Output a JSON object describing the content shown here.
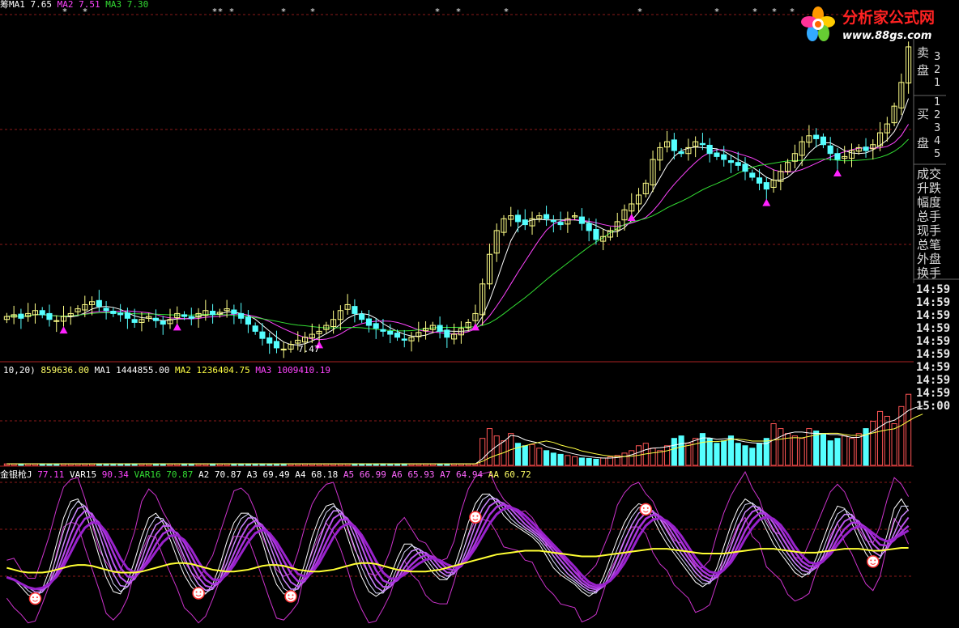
{
  "panels": {
    "price": {
      "legend": [
        {
          "text": "筹MA1",
          "color": "#ffffff"
        },
        {
          "text": "7.65",
          "color": "#ffffff"
        },
        {
          "text": "MA2",
          "color": "#ff44ff"
        },
        {
          "text": "7.51",
          "color": "#ff44ff"
        },
        {
          "text": "MA3",
          "color": "#33dd33"
        },
        {
          "text": "7.30",
          "color": "#33dd33"
        }
      ],
      "low_annotation": "7.47"
    },
    "volume": {
      "legend": [
        {
          "text": "10,20)",
          "color": "#ffffff"
        },
        {
          "text": "859636.00",
          "color": "#ffff66"
        },
        {
          "text": "MA1",
          "color": "#ffffff"
        },
        {
          "text": "1444855.00",
          "color": "#ffffff"
        },
        {
          "text": "MA2",
          "color": "#ffff44"
        },
        {
          "text": "1236404.75",
          "color": "#ffff44"
        },
        {
          "text": "MA3",
          "color": "#ff44ff"
        },
        {
          "text": "1009410.19",
          "color": "#ff44ff"
        }
      ]
    },
    "indicator": {
      "legend": [
        {
          "text": "金银枪J",
          "color": "#ffffff"
        },
        {
          "text": "77.11",
          "color": "#ff44ff"
        },
        {
          "text": "VAR15",
          "color": "#ffffff"
        },
        {
          "text": "90.34",
          "color": "#ff44ff"
        },
        {
          "text": "VAR16",
          "color": "#33dd33"
        },
        {
          "text": "70.87",
          "color": "#33dd33"
        },
        {
          "text": "A2",
          "color": "#ffffff"
        },
        {
          "text": "70.87",
          "color": "#ffffff"
        },
        {
          "text": "A3",
          "color": "#ffffff"
        },
        {
          "text": "69.49",
          "color": "#ffffff"
        },
        {
          "text": "A4",
          "color": "#ffffff"
        },
        {
          "text": "68.18",
          "color": "#ffffff"
        },
        {
          "text": "A5",
          "color": "#ff66ff"
        },
        {
          "text": "66.99",
          "color": "#ff66ff"
        },
        {
          "text": "A6",
          "color": "#ff66ff"
        },
        {
          "text": "65.93",
          "color": "#ff66ff"
        },
        {
          "text": "A7",
          "color": "#ff66ff"
        },
        {
          "text": "64.94",
          "color": "#ff66ff"
        },
        {
          "text": "AA",
          "color": "#ffff66"
        },
        {
          "text": "60.72",
          "color": "#ffff66"
        }
      ]
    }
  },
  "side_panel": {
    "sell_label": [
      "卖",
      "盘"
    ],
    "sell_nums": [
      "3",
      "2",
      "1"
    ],
    "buy_label": [
      "买",
      "盘"
    ],
    "buy_nums": [
      "1",
      "2",
      "3",
      "4",
      "5"
    ],
    "fields": [
      "成交",
      "升跌",
      "幅度",
      "总手",
      "现手",
      "总笔",
      "外盘",
      "换手"
    ],
    "times": [
      "14:59",
      "14:59",
      "14:59",
      "14:59",
      "14:59",
      "14:59",
      "14:59",
      "14:59",
      "14:59",
      "15:00"
    ]
  },
  "watermark": {
    "name": "分析家公式网",
    "url": "www.88gs.com"
  },
  "colors": {
    "up_candle": "#ffff88",
    "down_candle": "#55ffff",
    "vol_up": "#ff5555",
    "vol_down": "#55ffff",
    "grid": "#8b1a1a",
    "ma1": "#ffffff",
    "ma2": "#ff44ff",
    "ma3": "#33dd33",
    "signal": "#ff22ff",
    "aa": "#ffff33"
  },
  "chart_data": {
    "type": "candlestick",
    "bars": 128,
    "price": {
      "ylim": [
        6.5,
        12.4
      ],
      "close": [
        7.25,
        7.28,
        7.22,
        7.3,
        7.35,
        7.28,
        7.2,
        7.18,
        7.25,
        7.3,
        7.38,
        7.45,
        7.5,
        7.42,
        7.35,
        7.3,
        7.28,
        7.22,
        7.15,
        7.2,
        7.25,
        7.18,
        7.12,
        7.2,
        7.3,
        7.25,
        7.22,
        7.3,
        7.35,
        7.28,
        7.32,
        7.38,
        7.3,
        7.22,
        7.12,
        7.0,
        6.88,
        6.8,
        6.72,
        6.7,
        6.78,
        6.85,
        6.9,
        6.95,
        7.0,
        7.1,
        7.2,
        7.35,
        7.45,
        7.3,
        7.2,
        7.1,
        7.05,
        7.0,
        6.95,
        6.9,
        6.85,
        6.9,
        6.98,
        7.05,
        7.1,
        7.0,
        6.9,
        6.95,
        7.05,
        7.15,
        7.3,
        7.8,
        8.3,
        8.7,
        8.9,
        8.95,
        8.85,
        8.8,
        8.9,
        8.95,
        8.9,
        8.85,
        8.8,
        8.9,
        8.95,
        8.82,
        8.7,
        8.55,
        8.6,
        8.7,
        8.85,
        9.05,
        9.15,
        9.3,
        9.5,
        9.9,
        10.1,
        10.2,
        10.05,
        10.0,
        10.1,
        10.2,
        10.15,
        10.0,
        9.95,
        9.9,
        9.85,
        9.8,
        9.7,
        9.6,
        9.5,
        9.4,
        9.55,
        9.7,
        9.85,
        10.0,
        10.2,
        10.3,
        10.25,
        10.15,
        10.0,
        9.9,
        9.95,
        10.05,
        10.1,
        10.05,
        10.15,
        10.35,
        10.5,
        10.8,
        11.2,
        11.8
      ]
    },
    "volume": {
      "ylim": [
        0,
        3600000
      ],
      "values": [
        60000,
        60000,
        60000,
        60000,
        60000,
        60000,
        60000,
        60000,
        60000,
        60000,
        60000,
        60000,
        60000,
        60000,
        60000,
        60000,
        60000,
        60000,
        60000,
        60000,
        60000,
        60000,
        60000,
        60000,
        60000,
        60000,
        60000,
        60000,
        60000,
        60000,
        60000,
        60000,
        60000,
        60000,
        60000,
        60000,
        60000,
        60000,
        60000,
        60000,
        60000,
        60000,
        60000,
        60000,
        60000,
        60000,
        60000,
        60000,
        60000,
        60000,
        60000,
        60000,
        60000,
        60000,
        60000,
        60000,
        60000,
        60000,
        60000,
        60000,
        60000,
        60000,
        60000,
        60000,
        60000,
        60000,
        60000,
        1100000,
        1500000,
        1200000,
        1000000,
        1300000,
        900000,
        800000,
        850000,
        700000,
        600000,
        500000,
        450000,
        400000,
        350000,
        300000,
        280000,
        250000,
        300000,
        350000,
        400000,
        500000,
        600000,
        800000,
        900000,
        700000,
        600000,
        800000,
        1100000,
        1200000,
        900000,
        1100000,
        1300000,
        1100000,
        900000,
        1000000,
        1200000,
        900000,
        800000,
        700000,
        900000,
        1100000,
        1700000,
        1500000,
        1300000,
        1200000,
        1100000,
        1500000,
        1400000,
        1300000,
        1000000,
        1100000,
        1200000,
        1100000,
        1300000,
        1500000,
        1800000,
        2200000,
        2000000,
        1700000,
        2400000,
        2900000,
        2800000,
        2300000
      ]
    },
    "oscillator": {
      "ylim": [
        -20,
        130
      ],
      "J": [
        30,
        25,
        15,
        8,
        10,
        25,
        50,
        80,
        105,
        115,
        110,
        90,
        65,
        40,
        20,
        10,
        15,
        35,
        60,
        85,
        100,
        95,
        80,
        60,
        40,
        25,
        15,
        10,
        15,
        30,
        55,
        80,
        95,
        100,
        95,
        80,
        55,
        30,
        15,
        10,
        15,
        30,
        60,
        85,
        100,
        110,
        105,
        85,
        60,
        40,
        20,
        10,
        10,
        20,
        40,
        60,
        70,
        60,
        50,
        40,
        30,
        25,
        30,
        50,
        75,
        100,
        115,
        120,
        115,
        100,
        90,
        85,
        80,
        75,
        70,
        60,
        45,
        35,
        30,
        25,
        20,
        10,
        10,
        20,
        40,
        60,
        80,
        95,
        105,
        110,
        100,
        85,
        70,
        60,
        50,
        40,
        30,
        20,
        20,
        30,
        50,
        75,
        95,
        110,
        115,
        100,
        90,
        70,
        60,
        50,
        40,
        30,
        30,
        40,
        60,
        80,
        100,
        110,
        95,
        80,
        60,
        50,
        40,
        60,
        90,
        115,
        110,
        90
      ],
      "AA": [
        40,
        38,
        36,
        35,
        35,
        35,
        36,
        38,
        40,
        42,
        43,
        43,
        42,
        40,
        38,
        36,
        35,
        35,
        35,
        36,
        38,
        40,
        42,
        44,
        45,
        45,
        44,
        42,
        40,
        38,
        37,
        36,
        36,
        37,
        38,
        40,
        42,
        43,
        43,
        42,
        40,
        38,
        37,
        36,
        36,
        37,
        38,
        40,
        42,
        44,
        45,
        45,
        44,
        42,
        40,
        38,
        37,
        36,
        36,
        36,
        37,
        38,
        40,
        42,
        44,
        46,
        48,
        50,
        52,
        54,
        55,
        56,
        57,
        58,
        58,
        58,
        57,
        56,
        55,
        54,
        53,
        52,
        52,
        52,
        53,
        54,
        55,
        56,
        57,
        58,
        59,
        60,
        60,
        60,
        59,
        58,
        57,
        56,
        55,
        55,
        55,
        55,
        56,
        57,
        58,
        59,
        60,
        60,
        60,
        59,
        58,
        57,
        56,
        56,
        56,
        57,
        58,
        59,
        60,
        60,
        60,
        59,
        58,
        58,
        59,
        60,
        61,
        61
      ]
    }
  }
}
